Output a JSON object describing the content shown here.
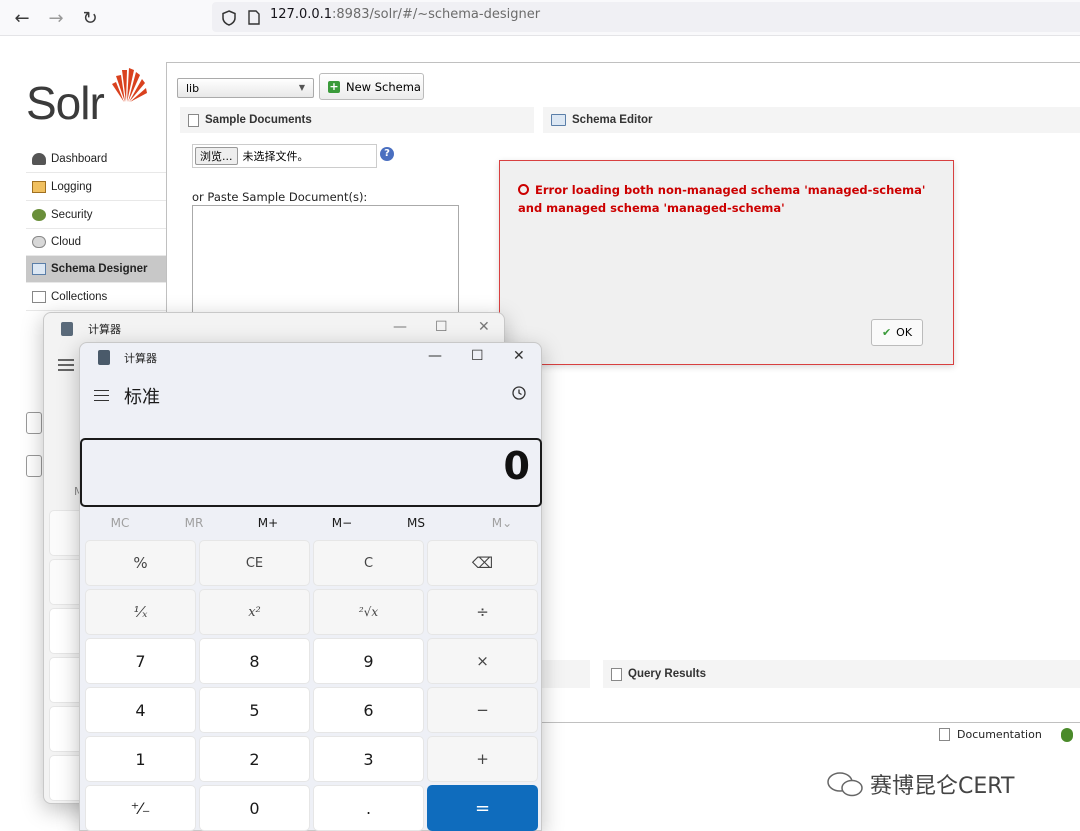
{
  "browser": {
    "back": "←",
    "forward": "→",
    "reload": "↻",
    "url_host": "127.0.0.1",
    "url_rest": ":8983/solr/#/~schema-designer"
  },
  "solr": {
    "logo_text": "Solr",
    "nav": [
      {
        "label": "Dashboard",
        "icon": "dashboard-icon"
      },
      {
        "label": "Logging",
        "icon": "logging-icon"
      },
      {
        "label": "Security",
        "icon": "security-icon"
      },
      {
        "label": "Cloud",
        "icon": "cloud-icon"
      },
      {
        "label": "Schema Designer",
        "icon": "schema-designer-icon",
        "active": true
      },
      {
        "label": "Collections",
        "icon": "collections-icon"
      }
    ],
    "schema_select": "lib",
    "new_schema": "New Schema",
    "sample_documents": "Sample Documents",
    "browse_button": "浏览...",
    "no_file": "未选择文件。",
    "paste_label": "or Paste Sample Document(s):",
    "schema_editor": "Schema Editor",
    "query_results": "Query Results",
    "documentation": "Documentation",
    "error_title": "Error loading both non-managed schema 'managed-schema' and managed schema 'managed-schema'",
    "ok_label": "OK"
  },
  "calc_back": {
    "title": "计算器",
    "minimize": "—",
    "maximize": "☐",
    "close": "✕"
  },
  "calc_front": {
    "title": "计算器",
    "mode": "标准",
    "display": "0",
    "minimize": "—",
    "maximize": "☐",
    "close": "✕",
    "memory": [
      {
        "label": "MC",
        "enabled": false
      },
      {
        "label": "MR",
        "enabled": false
      },
      {
        "label": "M+",
        "enabled": true
      },
      {
        "label": "M−",
        "enabled": true
      },
      {
        "label": "MS",
        "enabled": true
      },
      {
        "label": "M⌄",
        "enabled": false
      }
    ],
    "keys": [
      [
        "%",
        "CE",
        "C",
        "⌫"
      ],
      [
        "¹⁄ₓ",
        "x²",
        "²√x",
        "÷"
      ],
      [
        "7",
        "8",
        "9",
        "×"
      ],
      [
        "4",
        "5",
        "6",
        "−"
      ],
      [
        "1",
        "2",
        "3",
        "+"
      ],
      [
        "⁺⁄₋",
        "0",
        ".",
        "="
      ]
    ]
  },
  "watermark": "赛博昆仑CERT",
  "colors": {
    "error_red": "#cc0000",
    "equals_blue": "#0f6cbd",
    "solr_red": "#d9411e"
  }
}
